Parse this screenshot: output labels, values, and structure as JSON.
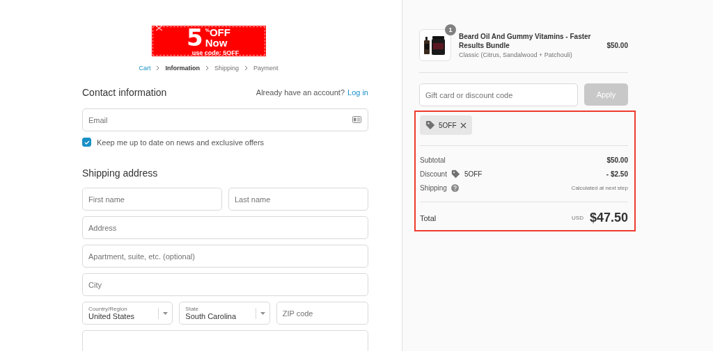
{
  "banner": {
    "big": "5",
    "percent": "%",
    "off": "OFF",
    "now": "Now",
    "code": "use code: 5OFF"
  },
  "breadcrumb": [
    {
      "label": "Cart",
      "kind": "link"
    },
    {
      "label": "Information",
      "kind": "current"
    },
    {
      "label": "Shipping",
      "kind": "upcoming"
    },
    {
      "label": "Payment",
      "kind": "upcoming"
    }
  ],
  "contact": {
    "title": "Contact information",
    "account_prompt": "Already have an account?",
    "login_link": "Log in",
    "email_placeholder": "Email",
    "newsletter": {
      "label": "Keep me up to date on news and exclusive offers",
      "checked": true
    }
  },
  "shipping": {
    "title": "Shipping address",
    "rows": [
      [
        {
          "kind": "text",
          "placeholder": "First name"
        },
        {
          "kind": "text",
          "placeholder": "Last name"
        }
      ],
      [
        {
          "kind": "text",
          "placeholder": "Address"
        }
      ],
      [
        {
          "kind": "text",
          "placeholder": "Apartment, suite, etc. (optional)"
        }
      ],
      [
        {
          "kind": "text",
          "placeholder": "City"
        }
      ],
      [
        {
          "kind": "select",
          "label": "Country/Region",
          "value": "United States"
        },
        {
          "kind": "select",
          "label": "State",
          "value": "South Carolina"
        },
        {
          "kind": "text",
          "placeholder": "ZIP code"
        }
      ],
      [
        {
          "kind": "text"
        }
      ]
    ]
  },
  "summary": {
    "item": {
      "quantity": "1",
      "name": "Beard Oil And Gummy Vitamins - Faster Results Bundle",
      "variant": "Classic (Citrus, Sandalwood + Patchouli)",
      "price": "$50.00"
    },
    "discount_input": {
      "placeholder": "Gift card or discount code"
    },
    "apply_button": {
      "label": "Apply",
      "disabled": true
    },
    "highlighted": true,
    "applied_code": "5OFF",
    "lines": [
      {
        "kind": "plain",
        "label": "Subtotal",
        "value": "$50.00"
      },
      {
        "kind": "discount",
        "label": "Discount",
        "code": "5OFF",
        "value": "- $2.50"
      },
      {
        "kind": "shipping",
        "label": "Shipping",
        "value": "Calculated at next step"
      }
    ],
    "total": {
      "label": "Total",
      "currency": "USD",
      "amount": "$47.50"
    }
  }
}
